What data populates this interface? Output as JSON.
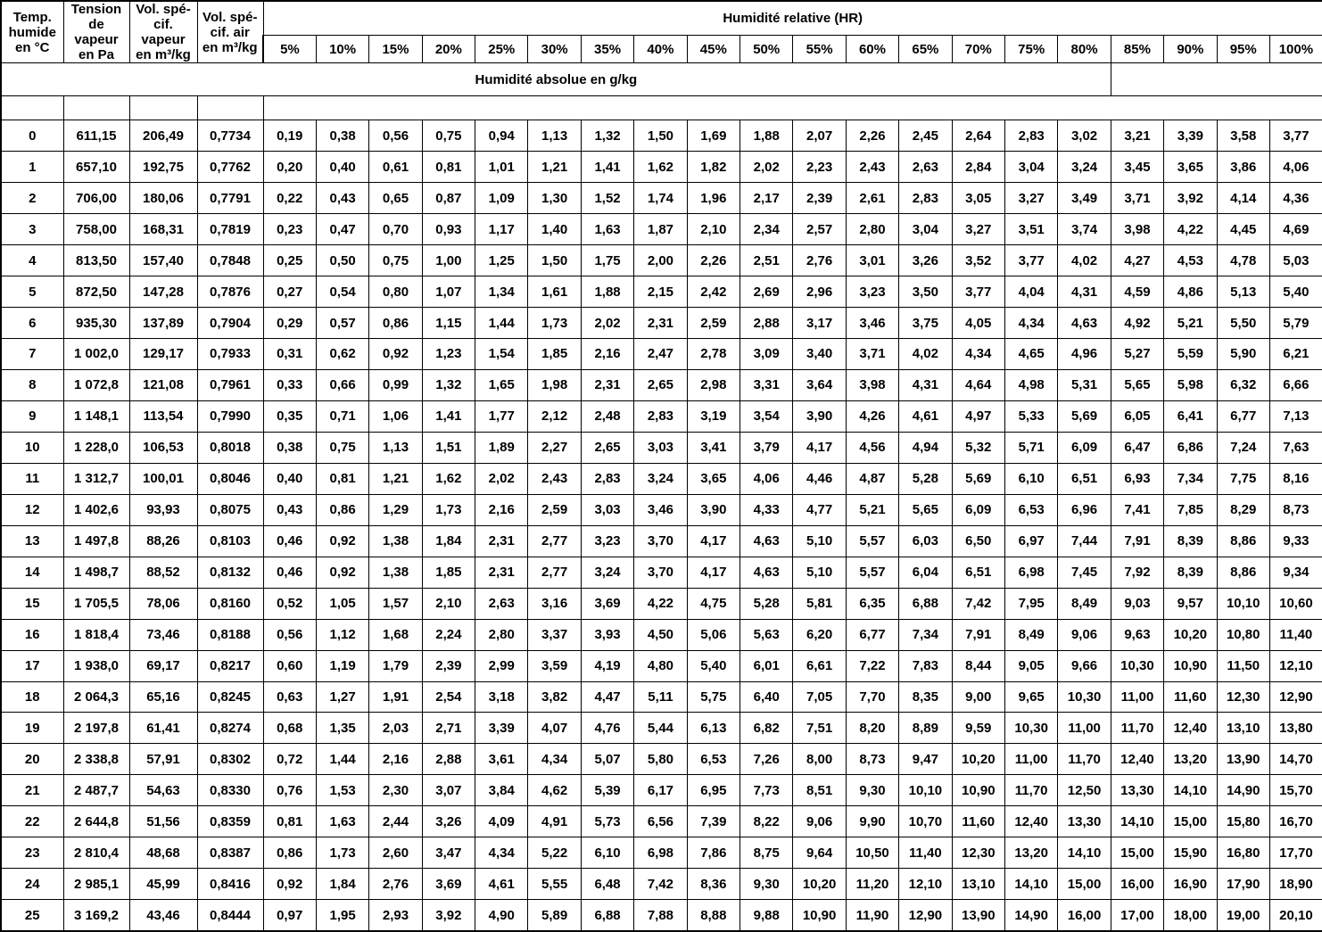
{
  "table": {
    "descriptor_headers": [
      "Temp.\nhumide\nen °C",
      "Tension\nde\nvapeur\nen Pa",
      "Vol. spé-\ncif.\nvapeur\nen m³/kg",
      "Vol. spé-\ncif. air\nen m³/kg"
    ],
    "group_title": "Humidité relative (HR)",
    "unit_banner": "Humidité absolue en g/kg",
    "humidity_columns": [
      "5%",
      "10%",
      "15%",
      "20%",
      "25%",
      "30%",
      "35%",
      "40%",
      "45%",
      "50%",
      "55%",
      "60%",
      "65%",
      "70%",
      "75%",
      "80%",
      "85%",
      "90%",
      "95%",
      "100%"
    ]
  },
  "chart_data": {
    "type": "table",
    "title": "Humidité relative (HR) — Humidité absolue en g/kg",
    "xlabel": "Humidité relative (HR)",
    "ylabel": "Temp. humide en °C",
    "categories": [
      "5%",
      "10%",
      "15%",
      "20%",
      "25%",
      "30%",
      "35%",
      "40%",
      "45%",
      "50%",
      "55%",
      "60%",
      "65%",
      "70%",
      "75%",
      "80%",
      "85%",
      "90%",
      "95%",
      "100%"
    ],
    "descriptor_columns": [
      "Temp. humide en °C",
      "Tension de vapeur en Pa",
      "Vol. spécif. vapeur en m³/kg",
      "Vol. spécif. air en m³/kg"
    ],
    "rows": [
      {
        "temp": "0",
        "tension": "611,15",
        "vol_vapeur": "206,49",
        "vol_air": "0,7734",
        "values": [
          "0,19",
          "0,38",
          "0,56",
          "0,75",
          "0,94",
          "1,13",
          "1,32",
          "1,50",
          "1,69",
          "1,88",
          "2,07",
          "2,26",
          "2,45",
          "2,64",
          "2,83",
          "3,02",
          "3,21",
          "3,39",
          "3,58",
          "3,77"
        ]
      },
      {
        "temp": "1",
        "tension": "657,10",
        "vol_vapeur": "192,75",
        "vol_air": "0,7762",
        "values": [
          "0,20",
          "0,40",
          "0,61",
          "0,81",
          "1,01",
          "1,21",
          "1,41",
          "1,62",
          "1,82",
          "2,02",
          "2,23",
          "2,43",
          "2,63",
          "2,84",
          "3,04",
          "3,24",
          "3,45",
          "3,65",
          "3,86",
          "4,06"
        ]
      },
      {
        "temp": "2",
        "tension": "706,00",
        "vol_vapeur": "180,06",
        "vol_air": "0,7791",
        "values": [
          "0,22",
          "0,43",
          "0,65",
          "0,87",
          "1,09",
          "1,30",
          "1,52",
          "1,74",
          "1,96",
          "2,17",
          "2,39",
          "2,61",
          "2,83",
          "3,05",
          "3,27",
          "3,49",
          "3,71",
          "3,92",
          "4,14",
          "4,36"
        ]
      },
      {
        "temp": "3",
        "tension": "758,00",
        "vol_vapeur": "168,31",
        "vol_air": "0,7819",
        "values": [
          "0,23",
          "0,47",
          "0,70",
          "0,93",
          "1,17",
          "1,40",
          "1,63",
          "1,87",
          "2,10",
          "2,34",
          "2,57",
          "2,80",
          "3,04",
          "3,27",
          "3,51",
          "3,74",
          "3,98",
          "4,22",
          "4,45",
          "4,69"
        ]
      },
      {
        "temp": "4",
        "tension": "813,50",
        "vol_vapeur": "157,40",
        "vol_air": "0,7848",
        "values": [
          "0,25",
          "0,50",
          "0,75",
          "1,00",
          "1,25",
          "1,50",
          "1,75",
          "2,00",
          "2,26",
          "2,51",
          "2,76",
          "3,01",
          "3,26",
          "3,52",
          "3,77",
          "4,02",
          "4,27",
          "4,53",
          "4,78",
          "5,03"
        ]
      },
      {
        "temp": "5",
        "tension": "872,50",
        "vol_vapeur": "147,28",
        "vol_air": "0,7876",
        "values": [
          "0,27",
          "0,54",
          "0,80",
          "1,07",
          "1,34",
          "1,61",
          "1,88",
          "2,15",
          "2,42",
          "2,69",
          "2,96",
          "3,23",
          "3,50",
          "3,77",
          "4,04",
          "4,31",
          "4,59",
          "4,86",
          "5,13",
          "5,40"
        ]
      },
      {
        "temp": "6",
        "tension": "935,30",
        "vol_vapeur": "137,89",
        "vol_air": "0,7904",
        "values": [
          "0,29",
          "0,57",
          "0,86",
          "1,15",
          "1,44",
          "1,73",
          "2,02",
          "2,31",
          "2,59",
          "2,88",
          "3,17",
          "3,46",
          "3,75",
          "4,05",
          "4,34",
          "4,63",
          "4,92",
          "5,21",
          "5,50",
          "5,79"
        ]
      },
      {
        "temp": "7",
        "tension": "1 002,0",
        "vol_vapeur": "129,17",
        "vol_air": "0,7933",
        "values": [
          "0,31",
          "0,62",
          "0,92",
          "1,23",
          "1,54",
          "1,85",
          "2,16",
          "2,47",
          "2,78",
          "3,09",
          "3,40",
          "3,71",
          "4,02",
          "4,34",
          "4,65",
          "4,96",
          "5,27",
          "5,59",
          "5,90",
          "6,21"
        ]
      },
      {
        "temp": "8",
        "tension": "1 072,8",
        "vol_vapeur": "121,08",
        "vol_air": "0,7961",
        "values": [
          "0,33",
          "0,66",
          "0,99",
          "1,32",
          "1,65",
          "1,98",
          "2,31",
          "2,65",
          "2,98",
          "3,31",
          "3,64",
          "3,98",
          "4,31",
          "4,64",
          "4,98",
          "5,31",
          "5,65",
          "5,98",
          "6,32",
          "6,66"
        ]
      },
      {
        "temp": "9",
        "tension": "1 148,1",
        "vol_vapeur": "113,54",
        "vol_air": "0,7990",
        "values": [
          "0,35",
          "0,71",
          "1,06",
          "1,41",
          "1,77",
          "2,12",
          "2,48",
          "2,83",
          "3,19",
          "3,54",
          "3,90",
          "4,26",
          "4,61",
          "4,97",
          "5,33",
          "5,69",
          "6,05",
          "6,41",
          "6,77",
          "7,13"
        ]
      },
      {
        "temp": "10",
        "tension": "1 228,0",
        "vol_vapeur": "106,53",
        "vol_air": "0,8018",
        "values": [
          "0,38",
          "0,75",
          "1,13",
          "1,51",
          "1,89",
          "2,27",
          "2,65",
          "3,03",
          "3,41",
          "3,79",
          "4,17",
          "4,56",
          "4,94",
          "5,32",
          "5,71",
          "6,09",
          "6,47",
          "6,86",
          "7,24",
          "7,63"
        ]
      },
      {
        "temp": "11",
        "tension": "1 312,7",
        "vol_vapeur": "100,01",
        "vol_air": "0,8046",
        "values": [
          "0,40",
          "0,81",
          "1,21",
          "1,62",
          "2,02",
          "2,43",
          "2,83",
          "3,24",
          "3,65",
          "4,06",
          "4,46",
          "4,87",
          "5,28",
          "5,69",
          "6,10",
          "6,51",
          "6,93",
          "7,34",
          "7,75",
          "8,16"
        ]
      },
      {
        "temp": "12",
        "tension": "1 402,6",
        "vol_vapeur": "93,93",
        "vol_air": "0,8075",
        "values": [
          "0,43",
          "0,86",
          "1,29",
          "1,73",
          "2,16",
          "2,59",
          "3,03",
          "3,46",
          "3,90",
          "4,33",
          "4,77",
          "5,21",
          "5,65",
          "6,09",
          "6,53",
          "6,96",
          "7,41",
          "7,85",
          "8,29",
          "8,73"
        ]
      },
      {
        "temp": "13",
        "tension": "1 497,8",
        "vol_vapeur": "88,26",
        "vol_air": "0,8103",
        "values": [
          "0,46",
          "0,92",
          "1,38",
          "1,84",
          "2,31",
          "2,77",
          "3,23",
          "3,70",
          "4,17",
          "4,63",
          "5,10",
          "5,57",
          "6,03",
          "6,50",
          "6,97",
          "7,44",
          "7,91",
          "8,39",
          "8,86",
          "9,33"
        ]
      },
      {
        "temp": "14",
        "tension": "1 498,7",
        "vol_vapeur": "88,52",
        "vol_air": "0,8132",
        "values": [
          "0,46",
          "0,92",
          "1,38",
          "1,85",
          "2,31",
          "2,77",
          "3,24",
          "3,70",
          "4,17",
          "4,63",
          "5,10",
          "5,57",
          "6,04",
          "6,51",
          "6,98",
          "7,45",
          "7,92",
          "8,39",
          "8,86",
          "9,34"
        ]
      },
      {
        "temp": "15",
        "tension": "1 705,5",
        "vol_vapeur": "78,06",
        "vol_air": "0,8160",
        "values": [
          "0,52",
          "1,05",
          "1,57",
          "2,10",
          "2,63",
          "3,16",
          "3,69",
          "4,22",
          "4,75",
          "5,28",
          "5,81",
          "6,35",
          "6,88",
          "7,42",
          "7,95",
          "8,49",
          "9,03",
          "9,57",
          "10,10",
          "10,60"
        ]
      },
      {
        "temp": "16",
        "tension": "1 818,4",
        "vol_vapeur": "73,46",
        "vol_air": "0,8188",
        "values": [
          "0,56",
          "1,12",
          "1,68",
          "2,24",
          "2,80",
          "3,37",
          "3,93",
          "4,50",
          "5,06",
          "5,63",
          "6,20",
          "6,77",
          "7,34",
          "7,91",
          "8,49",
          "9,06",
          "9,63",
          "10,20",
          "10,80",
          "11,40"
        ]
      },
      {
        "temp": "17",
        "tension": "1 938,0",
        "vol_vapeur": "69,17",
        "vol_air": "0,8217",
        "values": [
          "0,60",
          "1,19",
          "1,79",
          "2,39",
          "2,99",
          "3,59",
          "4,19",
          "4,80",
          "5,40",
          "6,01",
          "6,61",
          "7,22",
          "7,83",
          "8,44",
          "9,05",
          "9,66",
          "10,30",
          "10,90",
          "11,50",
          "12,10"
        ]
      },
      {
        "temp": "18",
        "tension": "2 064,3",
        "vol_vapeur": "65,16",
        "vol_air": "0,8245",
        "values": [
          "0,63",
          "1,27",
          "1,91",
          "2,54",
          "3,18",
          "3,82",
          "4,47",
          "5,11",
          "5,75",
          "6,40",
          "7,05",
          "7,70",
          "8,35",
          "9,00",
          "9,65",
          "10,30",
          "11,00",
          "11,60",
          "12,30",
          "12,90"
        ]
      },
      {
        "temp": "19",
        "tension": "2 197,8",
        "vol_vapeur": "61,41",
        "vol_air": "0,8274",
        "values": [
          "0,68",
          "1,35",
          "2,03",
          "2,71",
          "3,39",
          "4,07",
          "4,76",
          "5,44",
          "6,13",
          "6,82",
          "7,51",
          "8,20",
          "8,89",
          "9,59",
          "10,30",
          "11,00",
          "11,70",
          "12,40",
          "13,10",
          "13,80"
        ]
      },
      {
        "temp": "20",
        "tension": "2 338,8",
        "vol_vapeur": "57,91",
        "vol_air": "0,8302",
        "values": [
          "0,72",
          "1,44",
          "2,16",
          "2,88",
          "3,61",
          "4,34",
          "5,07",
          "5,80",
          "6,53",
          "7,26",
          "8,00",
          "8,73",
          "9,47",
          "10,20",
          "11,00",
          "11,70",
          "12,40",
          "13,20",
          "13,90",
          "14,70"
        ]
      },
      {
        "temp": "21",
        "tension": "2 487,7",
        "vol_vapeur": "54,63",
        "vol_air": "0,8330",
        "values": [
          "0,76",
          "1,53",
          "2,30",
          "3,07",
          "3,84",
          "4,62",
          "5,39",
          "6,17",
          "6,95",
          "7,73",
          "8,51",
          "9,30",
          "10,10",
          "10,90",
          "11,70",
          "12,50",
          "13,30",
          "14,10",
          "14,90",
          "15,70"
        ]
      },
      {
        "temp": "22",
        "tension": "2 644,8",
        "vol_vapeur": "51,56",
        "vol_air": "0,8359",
        "values": [
          "0,81",
          "1,63",
          "2,44",
          "3,26",
          "4,09",
          "4,91",
          "5,73",
          "6,56",
          "7,39",
          "8,22",
          "9,06",
          "9,90",
          "10,70",
          "11,60",
          "12,40",
          "13,30",
          "14,10",
          "15,00",
          "15,80",
          "16,70"
        ]
      },
      {
        "temp": "23",
        "tension": "2 810,4",
        "vol_vapeur": "48,68",
        "vol_air": "0,8387",
        "values": [
          "0,86",
          "1,73",
          "2,60",
          "3,47",
          "4,34",
          "5,22",
          "6,10",
          "6,98",
          "7,86",
          "8,75",
          "9,64",
          "10,50",
          "11,40",
          "12,30",
          "13,20",
          "14,10",
          "15,00",
          "15,90",
          "16,80",
          "17,70"
        ]
      },
      {
        "temp": "24",
        "tension": "2 985,1",
        "vol_vapeur": "45,99",
        "vol_air": "0,8416",
        "values": [
          "0,92",
          "1,84",
          "2,76",
          "3,69",
          "4,61",
          "5,55",
          "6,48",
          "7,42",
          "8,36",
          "9,30",
          "10,20",
          "11,20",
          "12,10",
          "13,10",
          "14,10",
          "15,00",
          "16,00",
          "16,90",
          "17,90",
          "18,90"
        ]
      },
      {
        "temp": "25",
        "tension": "3 169,2",
        "vol_vapeur": "43,46",
        "vol_air": "0,8444",
        "values": [
          "0,97",
          "1,95",
          "2,93",
          "3,92",
          "4,90",
          "5,89",
          "6,88",
          "7,88",
          "8,88",
          "9,88",
          "10,90",
          "11,90",
          "12,90",
          "13,90",
          "14,90",
          "16,00",
          "17,00",
          "18,00",
          "19,00",
          "20,10"
        ]
      }
    ]
  }
}
